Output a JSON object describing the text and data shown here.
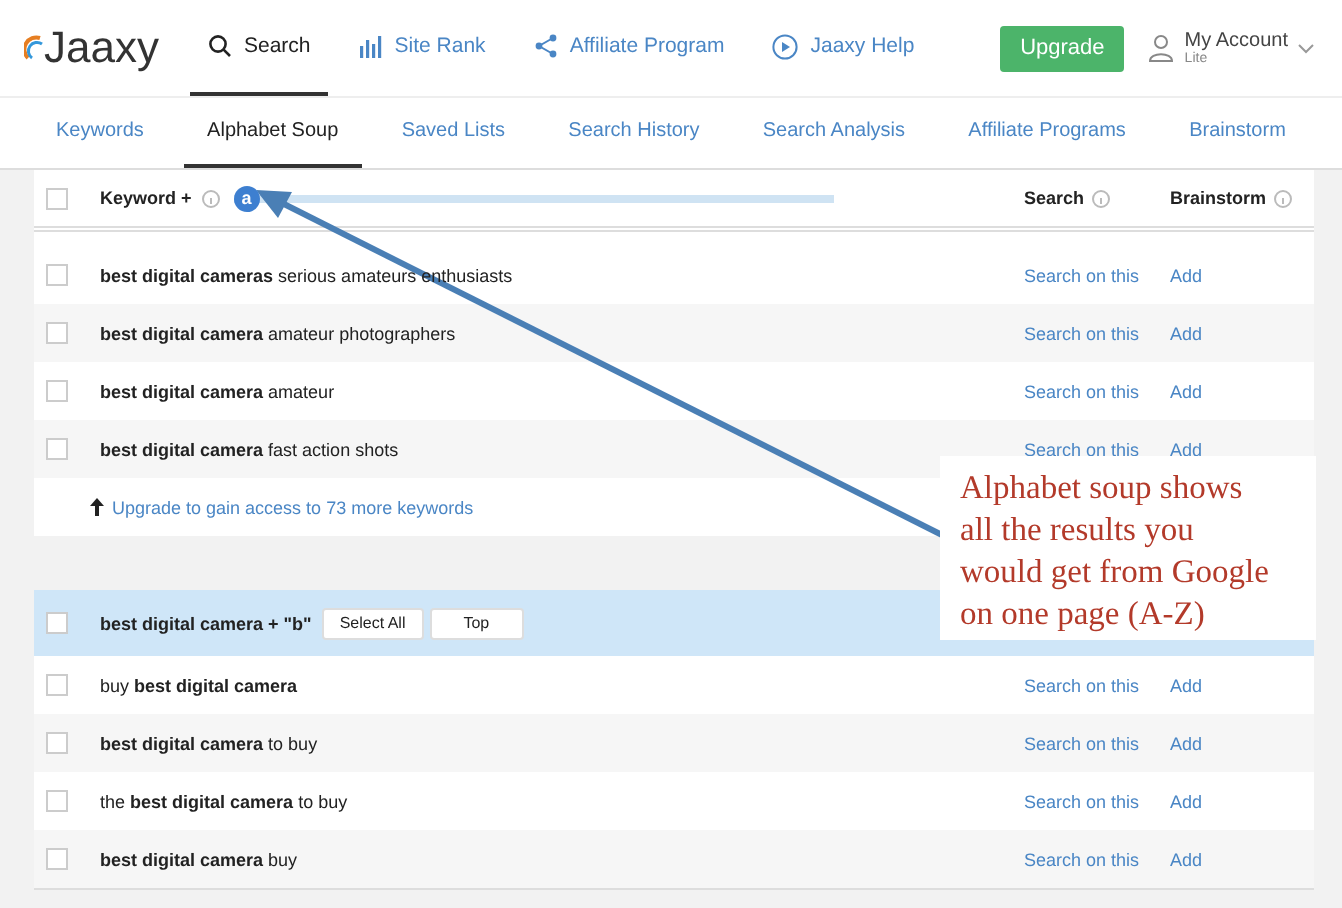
{
  "header": {
    "logo": "Jaaxy",
    "nav": [
      {
        "label": "Search",
        "kind": "search",
        "selected": true
      },
      {
        "label": "Site Rank",
        "kind": "chart",
        "selected": false
      },
      {
        "label": "Affiliate Program",
        "kind": "share",
        "selected": false
      },
      {
        "label": "Jaaxy Help",
        "kind": "play",
        "selected": false
      }
    ],
    "upgrade": "Upgrade",
    "account": {
      "name": "My Account",
      "plan": "Lite"
    }
  },
  "tabs": [
    {
      "label": "Keywords",
      "selected": false
    },
    {
      "label": "Alphabet Soup",
      "selected": true
    },
    {
      "label": "Saved Lists",
      "selected": false
    },
    {
      "label": "Search History",
      "selected": false
    },
    {
      "label": "Search Analysis",
      "selected": false
    },
    {
      "label": "Affiliate Programs",
      "selected": false
    },
    {
      "label": "Brainstorm",
      "selected": false
    }
  ],
  "table": {
    "header": {
      "checked": false,
      "keyword": "Keyword +",
      "letter": "a",
      "search": "Search",
      "brainstorm": "Brainstorm"
    },
    "sections": [
      {
        "rows": [
          {
            "checked": false,
            "keyword": "**best digital cameras** serious amateurs enthusiasts",
            "search": "Search on this",
            "add": "Add"
          },
          {
            "checked": false,
            "keyword": "**best digital camera** amateur photographers",
            "search": "Search on this",
            "add": "Add"
          },
          {
            "checked": false,
            "keyword": "**best digital camera** amateur",
            "search": "Search on this",
            "add": "Add"
          },
          {
            "checked": false,
            "keyword": "**best digital camera** fast action shots",
            "search": "Search on this",
            "add": "Add"
          }
        ],
        "upgrade_link": "Upgrade to gain access to 73 more keywords"
      },
      {
        "group": {
          "checked": false,
          "title": "best digital camera + \"b\"",
          "select_all": "Select All",
          "top": "Top"
        },
        "rows": [
          {
            "checked": false,
            "keyword": "buy **best digital camera**",
            "search": "Search on this",
            "add": "Add"
          },
          {
            "checked": false,
            "keyword": "**best digital camera** to buy",
            "search": "Search on this",
            "add": "Add"
          },
          {
            "checked": false,
            "keyword": "the **best digital camera** to buy",
            "search": "Search on this",
            "add": "Add"
          },
          {
            "checked": false,
            "keyword": "**best digital camera** buy",
            "search": "Search on this",
            "add": "Add"
          }
        ]
      }
    ]
  },
  "annotation": {
    "text": "Alphabet soup shows all the results you would get from Google on one page (A-Z)"
  }
}
